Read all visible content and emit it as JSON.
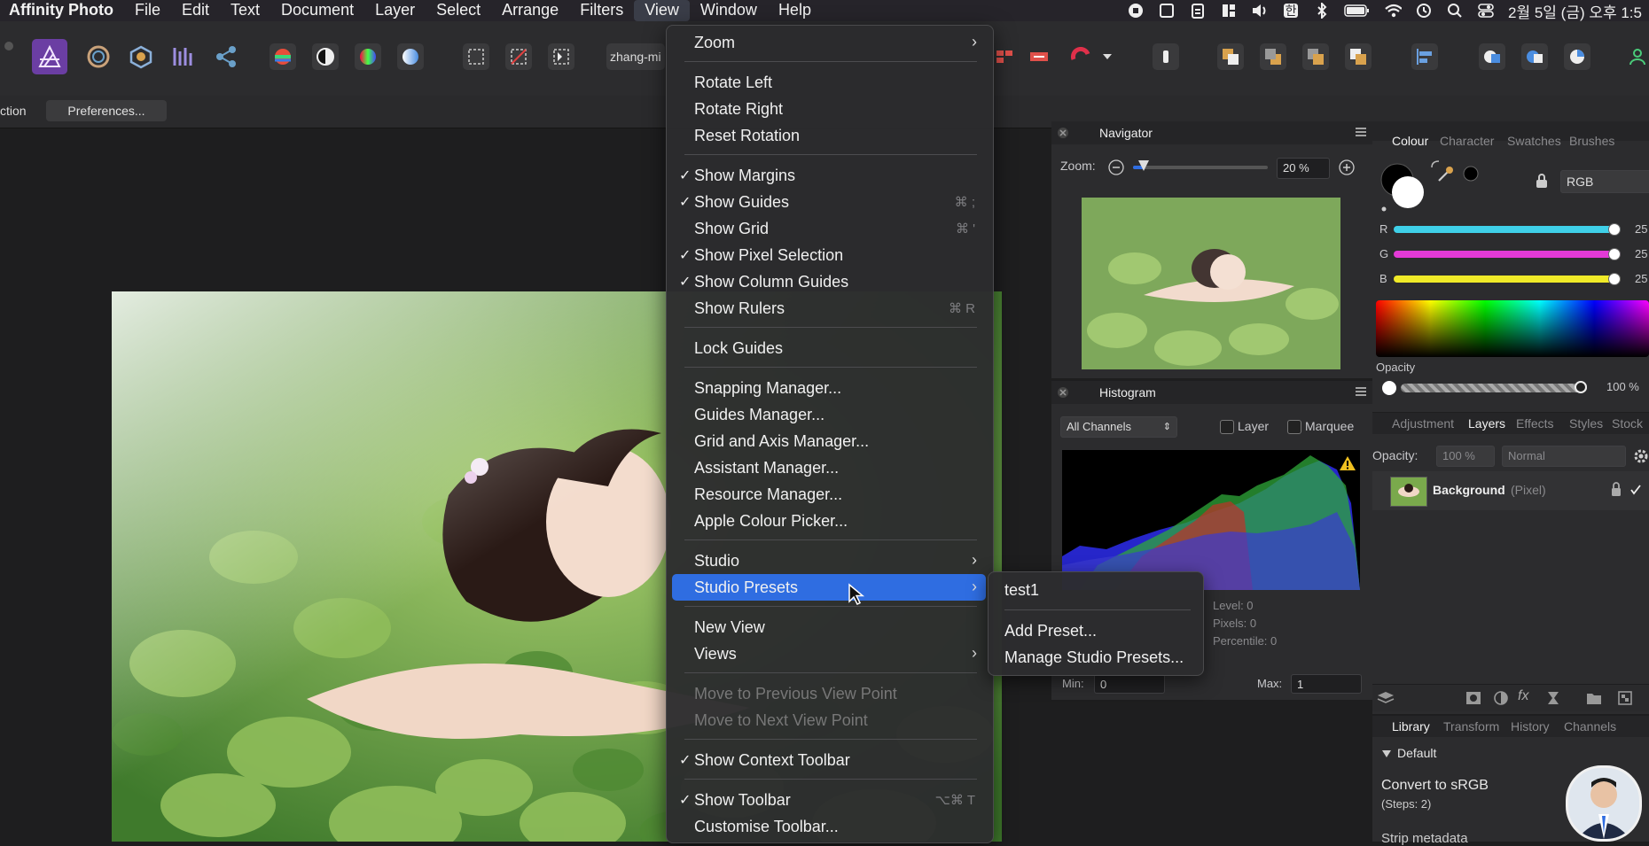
{
  "menubar": {
    "app_name": "Affinity Photo",
    "items": [
      "File",
      "Edit",
      "Text",
      "Document",
      "Layer",
      "Select",
      "Arrange",
      "Filters",
      "View",
      "Window",
      "Help"
    ],
    "active": "View",
    "clock": "2월 5일 (금) 오후 1:5",
    "ime_label": "한"
  },
  "toolbar": {
    "persona_label": "zhang-mi"
  },
  "context": {
    "label": "ction",
    "preferences_button": "Preferences..."
  },
  "view_menu": {
    "items": [
      {
        "label": "Zoom",
        "submenu": true
      },
      {
        "label": "Rotate Left"
      },
      {
        "label": "Rotate Right"
      },
      {
        "label": "Reset Rotation"
      },
      {
        "label": "Show Margins",
        "checked": true
      },
      {
        "label": "Show Guides",
        "checked": true,
        "shortcut": "⌘ ;"
      },
      {
        "label": "Show Grid",
        "shortcut": "⌘ '"
      },
      {
        "label": "Show Pixel Selection",
        "checked": true
      },
      {
        "label": "Show Column Guides",
        "checked": true
      },
      {
        "label": "Show Rulers",
        "shortcut": "⌘ R"
      },
      {
        "label": "Lock Guides"
      },
      {
        "label": "Snapping Manager..."
      },
      {
        "label": "Guides Manager..."
      },
      {
        "label": "Grid and Axis Manager..."
      },
      {
        "label": "Assistant Manager..."
      },
      {
        "label": "Resource Manager..."
      },
      {
        "label": "Apple Colour Picker..."
      },
      {
        "label": "Studio",
        "submenu": true
      },
      {
        "label": "Studio Presets",
        "submenu": true,
        "highlighted": true
      },
      {
        "label": "New View"
      },
      {
        "label": "Views",
        "submenu": true
      },
      {
        "label": "Move to Previous View Point",
        "disabled": true
      },
      {
        "label": "Move to Next View Point",
        "disabled": true
      },
      {
        "label": "Show Context Toolbar",
        "checked": true
      },
      {
        "label": "Show Toolbar",
        "checked": true,
        "shortcut": "⌥⌘ T"
      },
      {
        "label": "Customise Toolbar..."
      }
    ]
  },
  "studio_presets_submenu": {
    "items": [
      "test1",
      "Add Preset...",
      "Manage Studio Presets..."
    ]
  },
  "navigator": {
    "title": "Navigator",
    "zoom_label": "Zoom:",
    "zoom_value": "20 %",
    "zoom_fraction": 0.08
  },
  "histogram": {
    "title": "Histogram",
    "channel": "All Channels",
    "layer_label": "Layer",
    "marquee_label": "Marquee",
    "level": "Level: 0",
    "pixels": "Pixels: 0",
    "percentile": "Percentile: 0",
    "min_label": "Min:",
    "min_value": "0",
    "max_label": "Max:",
    "max_value": "1"
  },
  "colour_panel": {
    "tabs": [
      "Colour",
      "Character",
      "Swatches",
      "Brushes"
    ],
    "active_tab": "Colour",
    "mode": "RGB",
    "channels": [
      {
        "name": "R",
        "value": "25",
        "color": "#3fd0e8"
      },
      {
        "name": "G",
        "value": "25",
        "color": "#e33ad6"
      },
      {
        "name": "B",
        "value": "25",
        "color": "#f0ea28"
      }
    ],
    "opacity_label": "Opacity",
    "opacity_value": "100 %",
    "opacity_fraction": 1.0
  },
  "layers_panel": {
    "tabs": [
      "Adjustment",
      "Layers",
      "Effects",
      "Styles",
      "Stock"
    ],
    "active_tab": "Layers",
    "opacity_label": "Opacity:",
    "opacity_value": "100 %",
    "blend_mode": "Normal",
    "layer_name": "Background",
    "layer_type": "(Pixel)"
  },
  "library_panel": {
    "tabs": [
      "Library",
      "Transform",
      "History",
      "Channels"
    ],
    "active_tab": "Library",
    "category": "Default",
    "macro_name": "Convert to sRGB",
    "macro_steps": "(Steps: 2)",
    "macro_next": "Strip metadata"
  },
  "accent": "#2f6de1"
}
